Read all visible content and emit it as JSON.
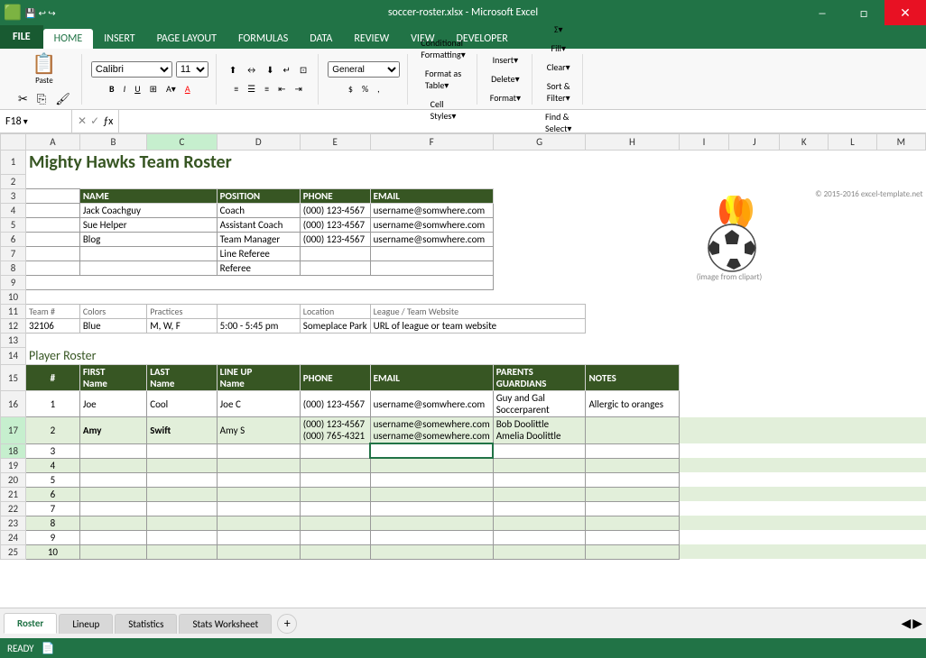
{
  "window": {
    "title": "soccer-roster.xlsx - Microsoft Excel"
  },
  "ribbon": {
    "tabs": [
      "FILE",
      "HOME",
      "INSERT",
      "PAGE LAYOUT",
      "FORMULAS",
      "DATA",
      "REVIEW",
      "VIEW",
      "DEVELOPER"
    ],
    "active_tab": "HOME"
  },
  "formula_bar": {
    "cell_ref": "F18",
    "formula": ""
  },
  "spreadsheet": {
    "title": "Mighty Hawks Team Roster",
    "columns": [
      "A",
      "B",
      "C",
      "D",
      "E",
      "F",
      "G",
      "H",
      "I",
      "J",
      "K",
      "L",
      "M"
    ],
    "staff_headers": [
      "NAME",
      "POSITION",
      "PHONE",
      "EMAIL"
    ],
    "staff_rows": [
      {
        "name": "Jack Coachguy",
        "position": "Coach",
        "phone": "(000) 123-4567",
        "email": "username@somwhere.com"
      },
      {
        "name": "Sue Helper",
        "position": "Assistant Coach",
        "phone": "(000) 123-4567",
        "email": "username@somwhere.com"
      },
      {
        "name": "Blog",
        "position": "Team Manager",
        "phone": "(000) 123-4567",
        "email": "username@somwhere.com"
      },
      {
        "name": "",
        "position": "Line Referee",
        "phone": "",
        "email": ""
      },
      {
        "name": "",
        "position": "Referee",
        "phone": "",
        "email": ""
      }
    ],
    "team_info_labels": [
      "Team #",
      "Colors",
      "Practices",
      "Location",
      "League / Team Website"
    ],
    "team_info_values": [
      "32106",
      "Blue",
      "M, W, F",
      "5:00 - 5:45 pm",
      "Someplace Park",
      "URL of league or team website"
    ],
    "player_roster_title": "Player Roster",
    "player_headers": [
      "#",
      "FIRST\nName",
      "LAST\nName",
      "LINE UP\nName",
      "PHONE",
      "EMAIL",
      "PARENTS\nGUARDIANS",
      "NOTES"
    ],
    "players": [
      {
        "num": "1",
        "first": "Joe",
        "last": "Cool",
        "lineup": "Joe C",
        "phone": "(000) 123-4567",
        "email": "username@somwhere.com",
        "parents": "Guy and Gal\nSoccerparent",
        "notes": "Allergic to oranges"
      },
      {
        "num": "2",
        "first": "Amy",
        "last": "Swift",
        "lineup": "Amy S",
        "phone": "(000) 123-4567\n(000) 765-4321",
        "email": "username@somewhere.com\nusername@somewhere.com",
        "parents": "Bob Doolittle\nAmelia Doolittle",
        "notes": ""
      },
      {
        "num": "3",
        "first": "",
        "last": "",
        "lineup": "",
        "phone": "",
        "email": "",
        "parents": "",
        "notes": ""
      },
      {
        "num": "4",
        "first": "",
        "last": "",
        "lineup": "",
        "phone": "",
        "email": "",
        "parents": "",
        "notes": ""
      },
      {
        "num": "5",
        "first": "",
        "last": "",
        "lineup": "",
        "phone": "",
        "email": "",
        "parents": "",
        "notes": ""
      },
      {
        "num": "6",
        "first": "",
        "last": "",
        "lineup": "",
        "phone": "",
        "email": "",
        "parents": "",
        "notes": ""
      },
      {
        "num": "7",
        "first": "",
        "last": "",
        "lineup": "",
        "phone": "",
        "email": "",
        "parents": "",
        "notes": ""
      },
      {
        "num": "8",
        "first": "",
        "last": "",
        "lineup": "",
        "phone": "",
        "email": "",
        "parents": "",
        "notes": ""
      },
      {
        "num": "9",
        "first": "",
        "last": "",
        "lineup": "",
        "phone": "",
        "email": "",
        "parents": "",
        "notes": ""
      },
      {
        "num": "10",
        "first": "",
        "last": "",
        "lineup": "",
        "phone": "",
        "email": "",
        "parents": "",
        "notes": ""
      }
    ],
    "copyright": "© 2015-2016 excel-template.net",
    "image_caption": "(image from clipart)"
  },
  "sheet_tabs": [
    "Roster",
    "Lineup",
    "Statistics",
    "Stats Worksheet"
  ],
  "active_sheet": "Roster",
  "status": "READY"
}
